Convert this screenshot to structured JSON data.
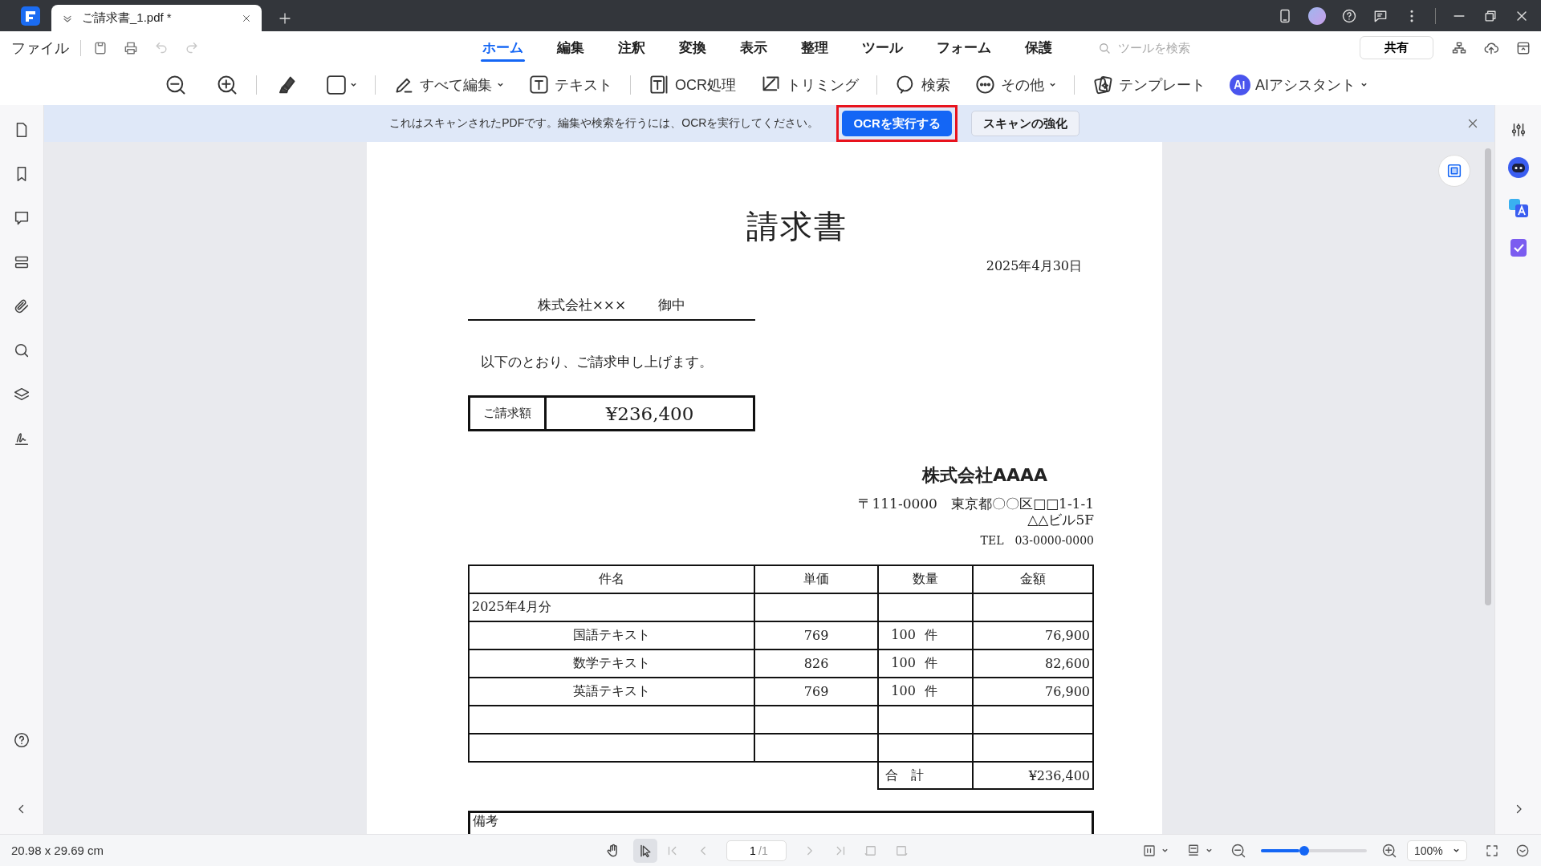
{
  "window": {
    "tab_title": "ご請求書_1.pdf *"
  },
  "menu": {
    "file": "ファイル",
    "tabs": [
      {
        "label": "ホーム",
        "selected": true
      },
      {
        "label": "編集",
        "selected": false
      },
      {
        "label": "注釈",
        "selected": false
      },
      {
        "label": "変換",
        "selected": false
      },
      {
        "label": "表示",
        "selected": false
      },
      {
        "label": "整理",
        "selected": false
      },
      {
        "label": "ツール",
        "selected": false
      },
      {
        "label": "フォーム",
        "selected": false
      },
      {
        "label": "保護",
        "selected": false
      }
    ],
    "search": {
      "placeholder": "ツールを検索"
    },
    "share": "共有"
  },
  "toolbar": [
    {
      "label": "すべて編集",
      "dropdown": true
    },
    {
      "label": "テキスト",
      "dropdown": false
    },
    {
      "label": "OCR処理",
      "dropdown": false
    },
    {
      "label": "トリミング",
      "dropdown": false
    },
    {
      "label": "検索",
      "dropdown": false
    },
    {
      "label": "その他",
      "dropdown": true
    },
    {
      "label": "テンプレート",
      "dropdown": false
    },
    {
      "label": "AIアシスタント",
      "dropdown": true
    }
  ],
  "notice": {
    "message": "これはスキャンされたPDFです。編集や検索を行うには、OCRを実行してください。",
    "buttons": [
      {
        "label": "OCRを実行する",
        "kind": "primary",
        "highlighted": true
      },
      {
        "label": "スキャンの強化",
        "kind": "secondary",
        "highlighted": false
      }
    ]
  },
  "document": {
    "title": "請求書",
    "date": "2025年4月30日",
    "recipient": {
      "name": "株式会社×××",
      "suffix": "御中"
    },
    "greeting": "以下のとおり、ご請求申し上げます。",
    "amount": {
      "label": "ご請求額",
      "value": "¥236,400"
    },
    "issuer": {
      "name": "株式会社AAAA",
      "address_1": "〒111-0000　東京都〇〇区□□1-1-1",
      "address_2": "△△ビル5F",
      "tel": "TEL　03-0000-0000"
    },
    "table": {
      "columns": [
        "件名",
        "単価",
        "数量",
        "金額"
      ],
      "rows": [
        {
          "kind": "period",
          "item": "2025年4月分"
        },
        {
          "kind": "line",
          "item": "国語テキスト",
          "unit_price": "769",
          "quantity": "100",
          "unit": "件",
          "amount": "76,900"
        },
        {
          "kind": "line",
          "item": "数学テキスト",
          "unit_price": "826",
          "quantity": "100",
          "unit": "件",
          "amount": "82,600"
        },
        {
          "kind": "line",
          "item": "英語テキスト",
          "unit_price": "769",
          "quantity": "100",
          "unit": "件",
          "amount": "76,900"
        },
        {
          "kind": "blank"
        },
        {
          "kind": "blank"
        }
      ],
      "total": {
        "label": "合　計",
        "value": "¥236,400"
      }
    },
    "notes_label": "備考"
  },
  "status_bar": {
    "page_size": "20.98 x 29.69 cm",
    "tools": [
      {
        "kind": "hand",
        "selected": false
      },
      {
        "kind": "select",
        "selected": true
      }
    ],
    "page": "1",
    "page_total": "/1",
    "zoom_slider": {
      "level": 0.41
    },
    "zoom": "100%"
  }
}
